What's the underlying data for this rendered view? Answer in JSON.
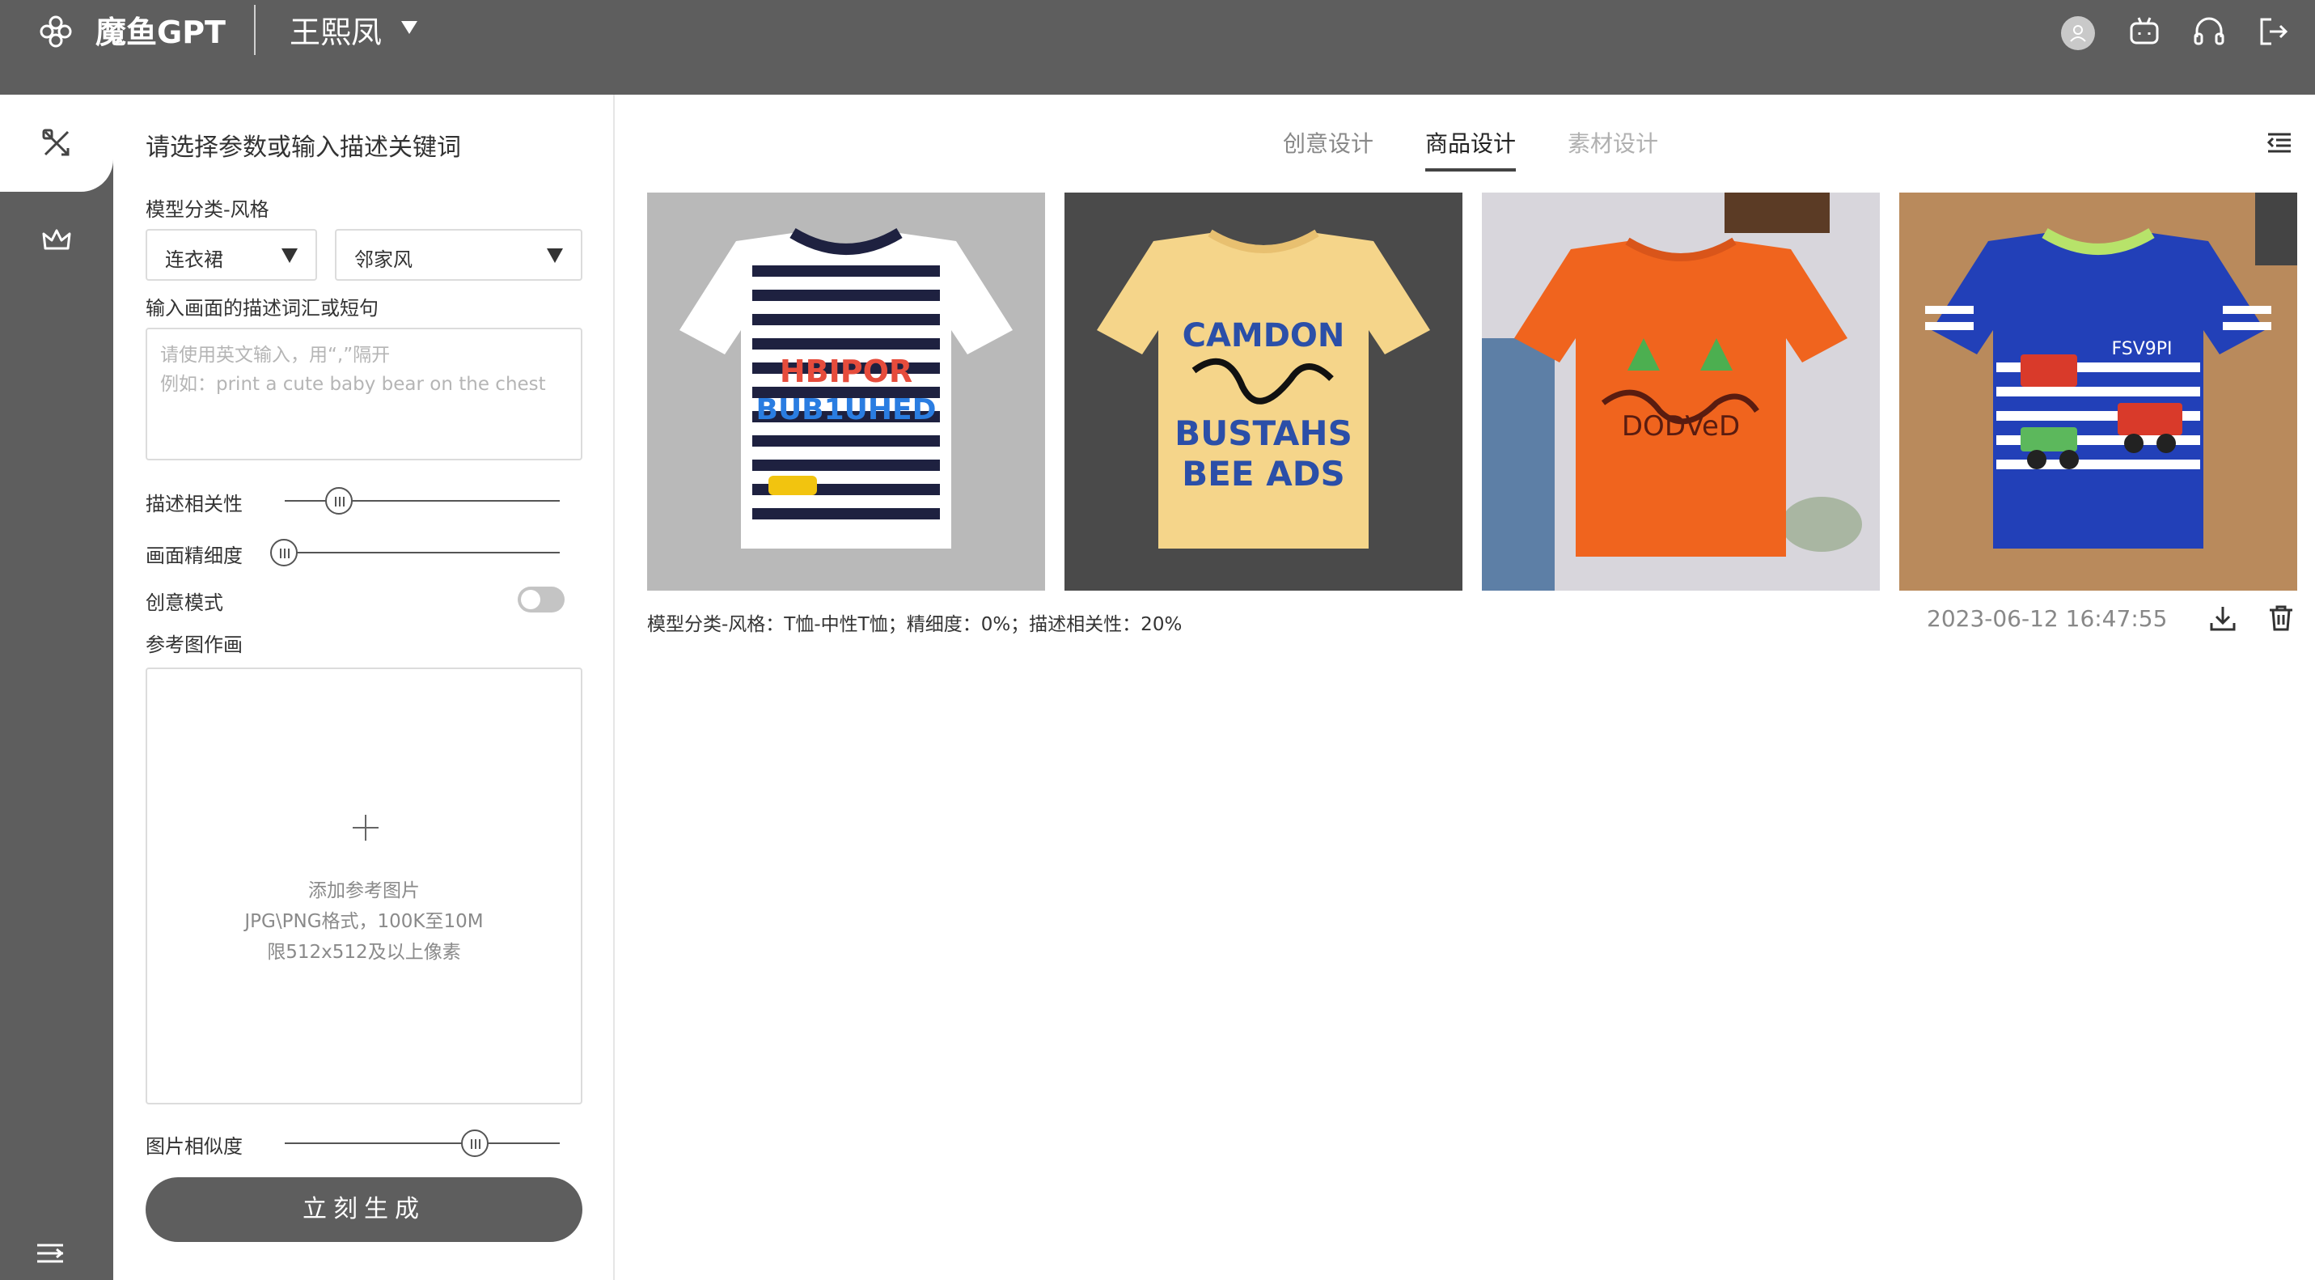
{
  "header": {
    "app_name": "魔鱼GPT",
    "user_name": "王熙凤",
    "icons": [
      "flower-logo-icon",
      "avatar-icon",
      "robot-icon",
      "headset-icon",
      "logout-icon"
    ]
  },
  "sidebar": {
    "items": [
      {
        "icon": "design-tools-icon",
        "active": true
      },
      {
        "icon": "crown-icon",
        "active": false
      }
    ],
    "collapse_icon": "collapse-icon"
  },
  "panel": {
    "title": "请选择参数或输入描述关键词",
    "model_label": "模型分类-风格",
    "select_category": "连衣裙",
    "select_style": "邻家风",
    "prompt_label": "输入画面的描述词汇或短句",
    "prompt_placeholder_line1": "请使用英文输入，用“,”隔开",
    "prompt_placeholder_line2": "例如：print a cute baby bear on the chest",
    "relevance_label": "描述相关性",
    "relevance_value": 0.2,
    "detail_label": "画面精细度",
    "detail_value": 0.0,
    "creative_label": "创意模式",
    "creative_on": false,
    "reference_label": "参考图作画",
    "upload_line1": "添加参考图片",
    "upload_line2": "JPG\\PNG格式，100K至10M",
    "upload_line3": "限512x512及以上像素",
    "similarity_label": "图片相似度",
    "similarity_value": 0.7,
    "generate_button": "立刻生成"
  },
  "main": {
    "tabs": [
      {
        "label": "创意设计",
        "active": false
      },
      {
        "label": "商品设计",
        "active": true
      },
      {
        "label": "素材设计",
        "active": false
      }
    ],
    "result": {
      "caption": "模型分类-风格：T恤-中性T恤；精细度：0%；描述相关性：20%",
      "timestamp": "2023-06-12 16:47:55",
      "images": [
        {
          "shirt_text_1": "HBIPOR",
          "shirt_text_2": "BUB1UHED",
          "bg": "#b9b9b9"
        },
        {
          "shirt_text_1": "CAMDON",
          "shirt_text_2": "BUSTAHS",
          "shirt_text_3": "BEE ADS",
          "bg": "#4a4a4a"
        },
        {
          "shirt_text_1": "DODVeD",
          "bg": "#d8d6dc"
        },
        {
          "shirt_text_1": "FSV9PI",
          "bg": "#b98a5c"
        }
      ]
    }
  }
}
